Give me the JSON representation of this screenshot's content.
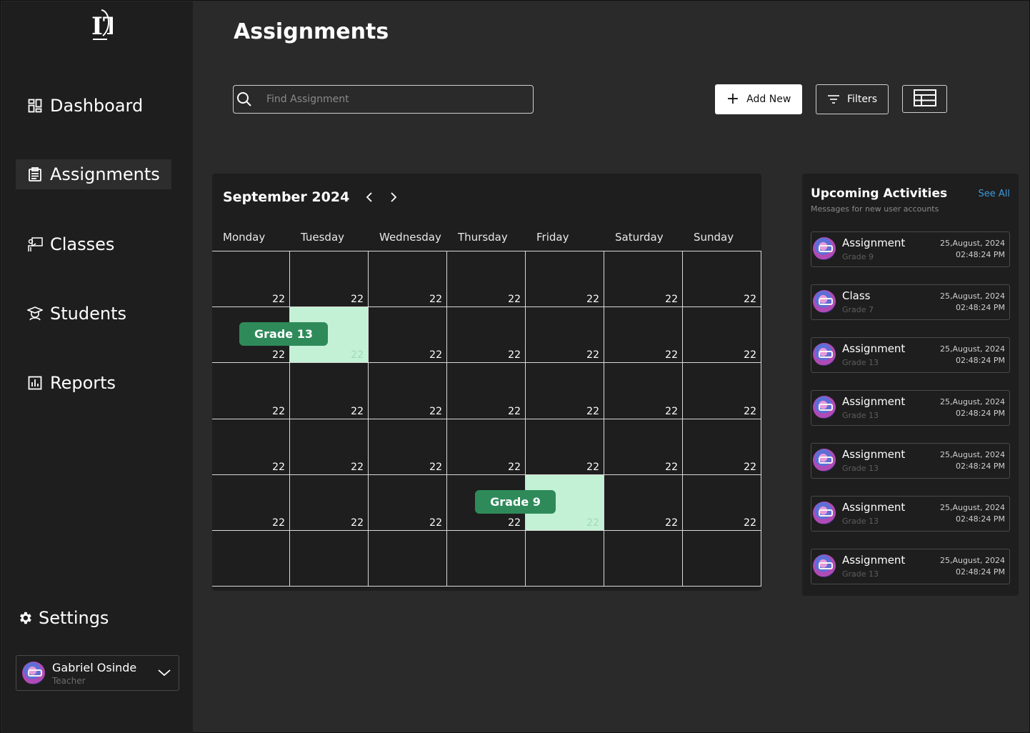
{
  "app": {
    "logo_text": "IT",
    "page_title": "Assignments"
  },
  "sidebar": {
    "items": [
      {
        "label": "Dashboard",
        "icon": "dashboard-icon"
      },
      {
        "label": "Assignments",
        "icon": "clipboard-icon",
        "active": true
      },
      {
        "label": "Classes",
        "icon": "teacher-board-icon"
      },
      {
        "label": "Students",
        "icon": "student-icon"
      },
      {
        "label": "Reports",
        "icon": "bar-chart-icon"
      }
    ],
    "settings_label": "Settings",
    "profile": {
      "name": "Gabriel Osinde",
      "role": "Teacher"
    }
  },
  "toolbar": {
    "search_placeholder": "Find Assignment",
    "add_label": "Add New",
    "filters_label": "Filters"
  },
  "calendar": {
    "month_title": "September  2024",
    "weekdays": [
      "Monday",
      "Tuesday",
      "Wednesday",
      "Thursday",
      "Friday",
      "Saturday",
      "Sunday"
    ],
    "day_number": "22",
    "events": [
      {
        "label": "Grade 13",
        "row": 1,
        "col": 1
      },
      {
        "label": "Grade 9",
        "row": 4,
        "col": 4
      }
    ],
    "highlight_color": "#c3f1d6",
    "event_color": "#2f8a5a"
  },
  "upcoming": {
    "title": "Upcoming  Activities",
    "subtitle": "Messages for new user accounts",
    "see_all": "See All",
    "items": [
      {
        "title": "Assignment",
        "grade": "Grade 9",
        "date": "25,August, 2024",
        "time": "02:48:24 PM"
      },
      {
        "title": "Class",
        "grade": "Grade 7",
        "date": "25,August, 2024",
        "time": "02:48:24 PM"
      },
      {
        "title": "Assignment",
        "grade": "Grade 13",
        "date": "25,August, 2024",
        "time": "02:48:24 PM"
      },
      {
        "title": "Assignment",
        "grade": "Grade 13",
        "date": "25,August, 2024",
        "time": "02:48:24 PM"
      },
      {
        "title": "Assignment",
        "grade": "Grade 13",
        "date": "25,August, 2024",
        "time": "02:48:24 PM"
      },
      {
        "title": "Assignment",
        "grade": "Grade 13",
        "date": "25,August, 2024",
        "time": "02:48:24 PM"
      },
      {
        "title": "Assignment",
        "grade": "Grade 13",
        "date": "25,August, 2024",
        "time": "02:48:24 PM"
      }
    ],
    "link_color": "#3d9bd9"
  }
}
